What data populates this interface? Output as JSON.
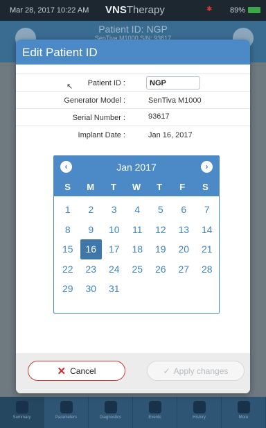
{
  "status_bar": {
    "time": "Mar 28, 2017  10:22 AM",
    "battery": "89%",
    "brand_bold": "VNS",
    "brand_light": "Therapy"
  },
  "app_header": {
    "title": "Patient ID: NGP",
    "subtitle": "SenTiva M1000 S/N: 93617"
  },
  "tabs": [
    "Summary",
    "Parameters",
    "Diagnostics",
    "Events",
    "History",
    "More"
  ],
  "modal": {
    "title": "Edit Patient ID",
    "fields": [
      {
        "label": "Patient ID :",
        "value": "NGP"
      },
      {
        "label": "Generator Model :",
        "value": "SenTiva M1000"
      },
      {
        "label": "Serial Number :",
        "value": "93617"
      },
      {
        "label": "Implant Date :",
        "value": "Jan 16, 2017"
      }
    ]
  },
  "calendar": {
    "month_label": "Jan 2017",
    "weekdays": [
      "S",
      "M",
      "T",
      "W",
      "T",
      "F",
      "S"
    ],
    "first_weekday_index": 0,
    "days_in_month": 31,
    "selected_day": 16,
    "prev_icon": "‹",
    "next_icon": "›"
  },
  "footer": {
    "cancel_label": "Cancel",
    "apply_label": "Apply changes"
  },
  "colors": {
    "accent": "#4b8ac6",
    "selected": "#3f78a8",
    "cancel_border": "#c8393a"
  }
}
